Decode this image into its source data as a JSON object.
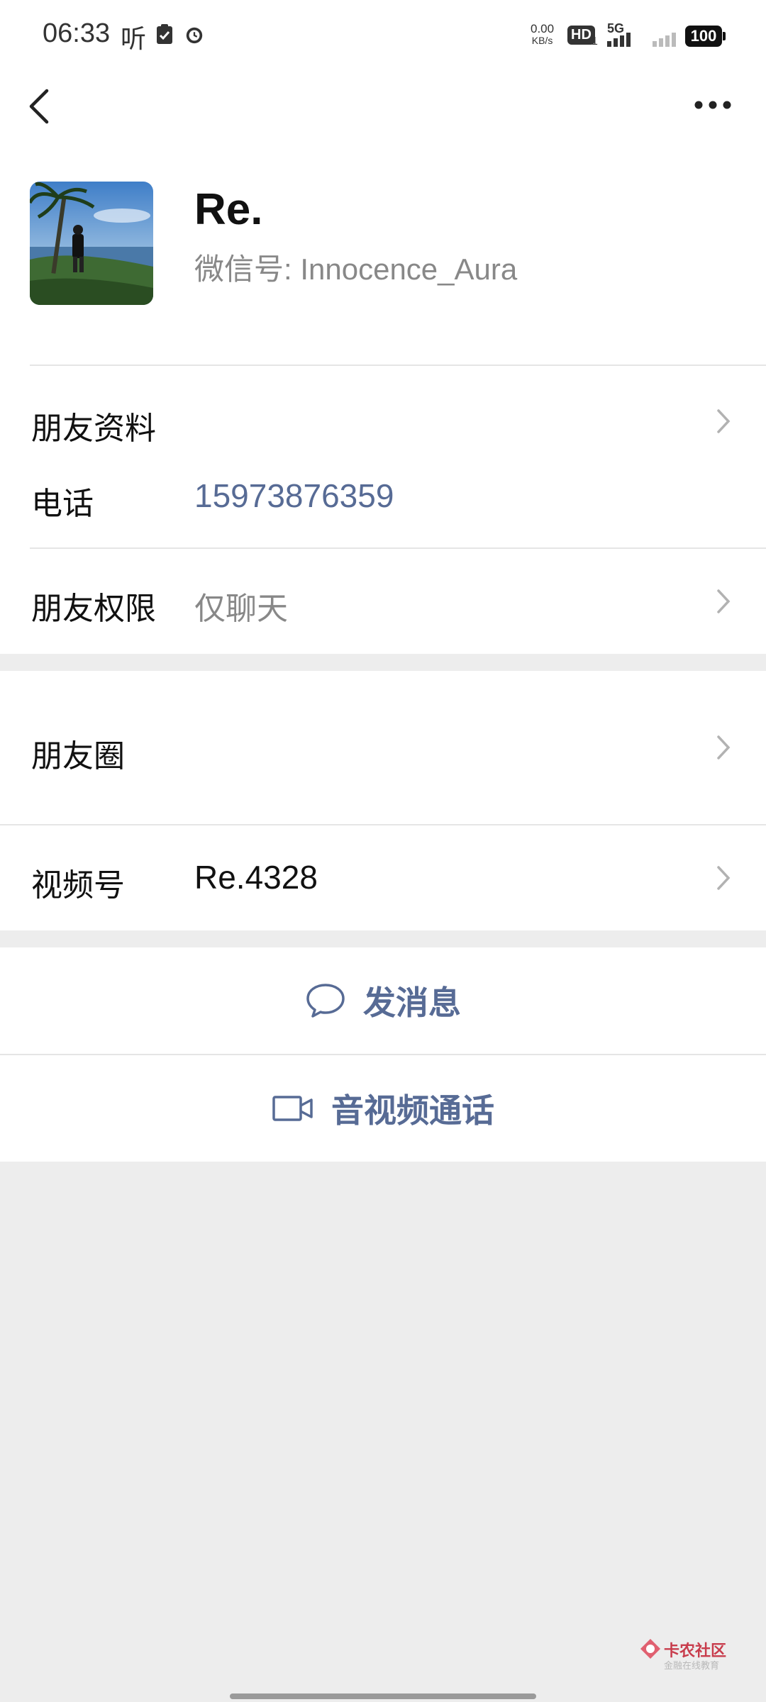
{
  "status_bar": {
    "time": "06:33",
    "extra_text": "听",
    "net_speed_value": "0.00",
    "net_speed_unit": "KB/s",
    "hd_label": "HD",
    "hd_sub": "1",
    "network_type": "5G",
    "battery": "100"
  },
  "nav": {
    "back_icon": "chevron-left-icon",
    "more_icon": "more-dots-icon"
  },
  "profile": {
    "name": "Re.",
    "wechat_id_label": "微信号:",
    "wechat_id": "Innocence_Aura"
  },
  "rows": {
    "friend_profile": {
      "label": "朋友资料"
    },
    "phone": {
      "label": "电话",
      "value": "15973876359"
    },
    "permissions": {
      "label": "朋友权限",
      "value": "仅聊天"
    },
    "moments": {
      "label": "朋友圈"
    },
    "channels": {
      "label": "视频号",
      "value": "Re.4328"
    }
  },
  "actions": {
    "message": {
      "label": "发消息",
      "icon": "chat-bubble-icon"
    },
    "call": {
      "label": "音视频通话",
      "icon": "video-camera-icon"
    }
  },
  "watermark": {
    "title": "卡农社区",
    "subtitle": "金融在线教育"
  },
  "colors": {
    "link_blue": "#576b95",
    "background_gray": "#ededed",
    "divider": "#e5e5e5"
  }
}
